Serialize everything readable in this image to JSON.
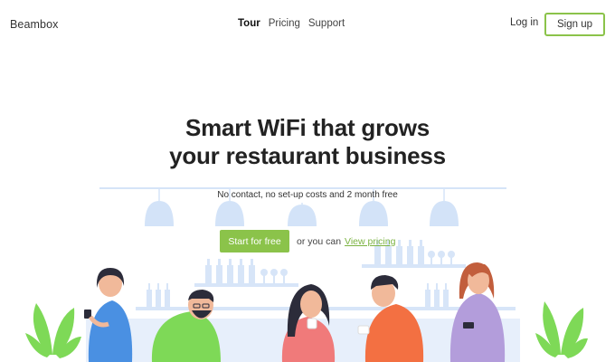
{
  "header": {
    "logo": "Beambox",
    "nav": [
      {
        "label": "Tour",
        "active": true
      },
      {
        "label": "Pricing",
        "active": false
      },
      {
        "label": "Support",
        "active": false
      }
    ],
    "login_label": "Log in",
    "signup_label": "Sign up"
  },
  "hero": {
    "title_line1": "Smart WiFi that grows",
    "title_line2": "your restaurant business",
    "subtitle": "No contact, no set-up costs and 2 month free",
    "cta_button": "Start for free",
    "cta_text": "or you can",
    "cta_link": "View pricing"
  },
  "colors": {
    "accent": "#8bc34a",
    "illustration_blue": "#cfe0f7",
    "plant_green": "#7ed957"
  },
  "illustration": {
    "name": "restaurant-people-illustration"
  }
}
